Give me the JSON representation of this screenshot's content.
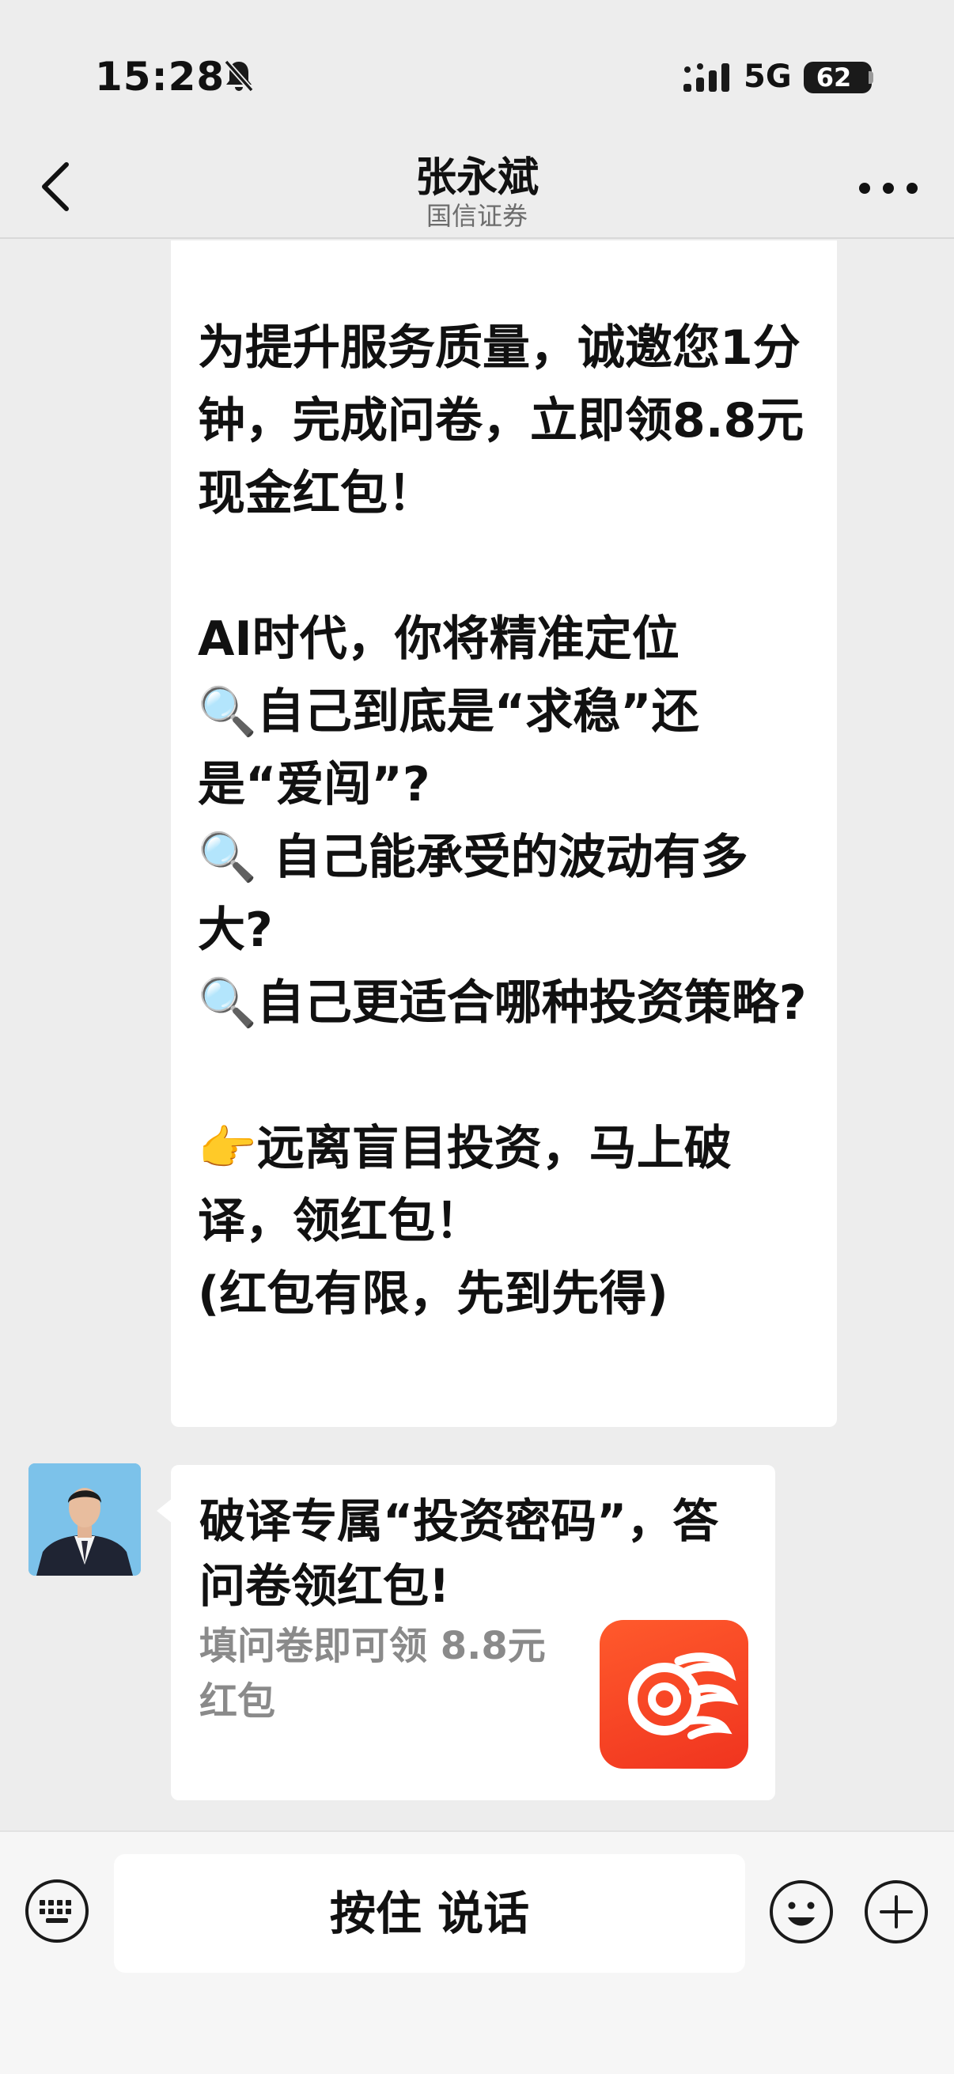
{
  "status_bar": {
    "time": "15:28",
    "network": "5G",
    "battery": "62",
    "battery_level": 0.62,
    "icons": [
      "bell-slash-icon",
      "signal-bars-icon",
      "battery-icon"
    ]
  },
  "nav": {
    "title": "张永斌",
    "subtitle": "国信证券",
    "icons": [
      "chevron-left-icon",
      "more-dots-icon"
    ]
  },
  "messages": {
    "main": {
      "lines": [
        "为提升服务质量，诚邀您1分钟，完成问卷，立即领8.8元现金红包！",
        "",
        "AI时代，你将精准定位",
        "🔍自己到底是“求稳”还是“爱闯”?",
        "🔍 自己能承受的波动有多大?",
        "🔍自己更适合哪种投资策略?",
        "",
        "👉远离盲目投资，马上破译，领红包！",
        "(红包有限，先到先得)"
      ]
    },
    "card": {
      "title": "破译专属“投资密码”，答问卷领红包!",
      "description": "填问卷即可领 8.8元红包",
      "logo_icon": "guosen-app-logo-icon",
      "avatar_icon": "user-avatar-photo"
    }
  },
  "input_bar": {
    "voice_label": "按住 说话",
    "icons": [
      "keyboard-icon",
      "emoji-icon",
      "plus-icon"
    ]
  }
}
